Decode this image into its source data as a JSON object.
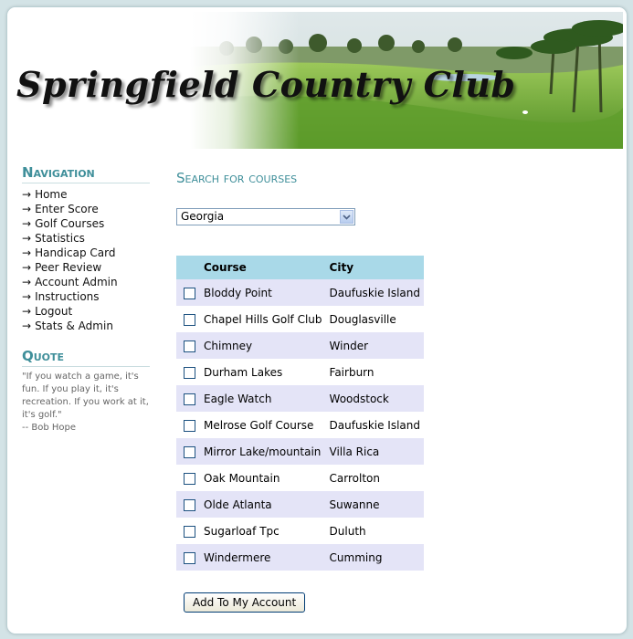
{
  "site": {
    "title": "Springfield Country Club"
  },
  "sidebar": {
    "nav_heading": "Navigation",
    "nav_items": [
      {
        "label": "Home"
      },
      {
        "label": "Enter Score"
      },
      {
        "label": "Golf Courses"
      },
      {
        "label": "Statistics"
      },
      {
        "label": "Handicap Card"
      },
      {
        "label": "Peer Review"
      },
      {
        "label": "Account Admin"
      },
      {
        "label": "Instructions"
      },
      {
        "label": "Logout"
      },
      {
        "label": "Stats & Admin"
      }
    ],
    "arrow": "→",
    "quote_heading": "Quote",
    "quote_text": "\"If you watch a game, it's fun. If you play it, it's recreation. If you work at it, it's golf.\"",
    "quote_author": "-- Bob Hope"
  },
  "main": {
    "heading": "Search for courses",
    "state_select": {
      "selected": "Georgia"
    },
    "table": {
      "headers": {
        "course": "Course",
        "city": "City"
      },
      "rows": [
        {
          "course": "Bloddy Point",
          "city": "Daufuskie Island"
        },
        {
          "course": "Chapel Hills Golf Club",
          "city": "Douglasville"
        },
        {
          "course": "Chimney",
          "city": "Winder"
        },
        {
          "course": "Durham Lakes",
          "city": "Fairburn"
        },
        {
          "course": "Eagle Watch",
          "city": "Woodstock"
        },
        {
          "course": "Melrose Golf Course",
          "city": "Daufuskie Island"
        },
        {
          "course": "Mirror Lake/mountain",
          "city": "Villa Rica"
        },
        {
          "course": "Oak Mountain",
          "city": "Carrolton"
        },
        {
          "course": "Olde Atlanta",
          "city": "Suwanne"
        },
        {
          "course": "Sugarloaf Tpc",
          "city": "Duluth"
        },
        {
          "course": "Windermere",
          "city": "Cumming"
        }
      ]
    },
    "add_button": "Add To My Account"
  },
  "colors": {
    "accent": "#3f8f9a",
    "table_header": "#a9d9e8",
    "row_alt": "#e4e4f7",
    "page_bg": "#d3e3e6"
  }
}
